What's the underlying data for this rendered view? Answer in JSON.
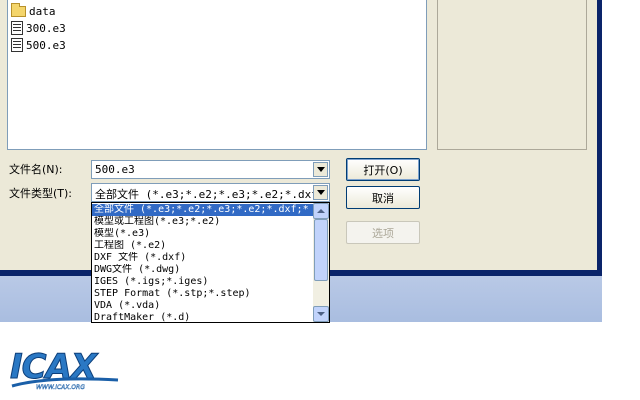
{
  "file_list": {
    "items": [
      {
        "name": "data",
        "icon": "folder-icon"
      },
      {
        "name": "300.e3",
        "icon": "document-icon"
      },
      {
        "name": "500.e3",
        "icon": "document-icon"
      }
    ]
  },
  "filename": {
    "label": "文件名(N):",
    "value": "500.e3"
  },
  "filetype": {
    "label": "文件类型(T):",
    "value": "全部文件 (*.e3;*.e2;*.e3;*.e2;*.dxf;*"
  },
  "buttons": {
    "open": "打开(O)",
    "cancel": "取消",
    "options": "选项"
  },
  "dropdown": {
    "options": [
      "全部文件 (*.e3;*.e2;*.e3;*.e2;*.dxf;*",
      "模型或工程图(*.e3;*.e2)",
      "模型(*.e3)",
      "工程图 (*.e2)",
      "DXF 文件 (*.dxf)",
      "DWG文件 (*.dwg)",
      "IGES (*.igs;*.iges)",
      "STEP Format (*.stp;*.step)",
      "VDA (*.vda)",
      "DraftMaker (*.d)"
    ],
    "selected_index": 0
  },
  "logo": {
    "text": "ICAX",
    "url_text": "WWW.ICAX.ORG"
  },
  "colors": {
    "selection": "#316ac5",
    "dialog_bg": "#ece9d8",
    "frame_blue": "#0a246a"
  }
}
